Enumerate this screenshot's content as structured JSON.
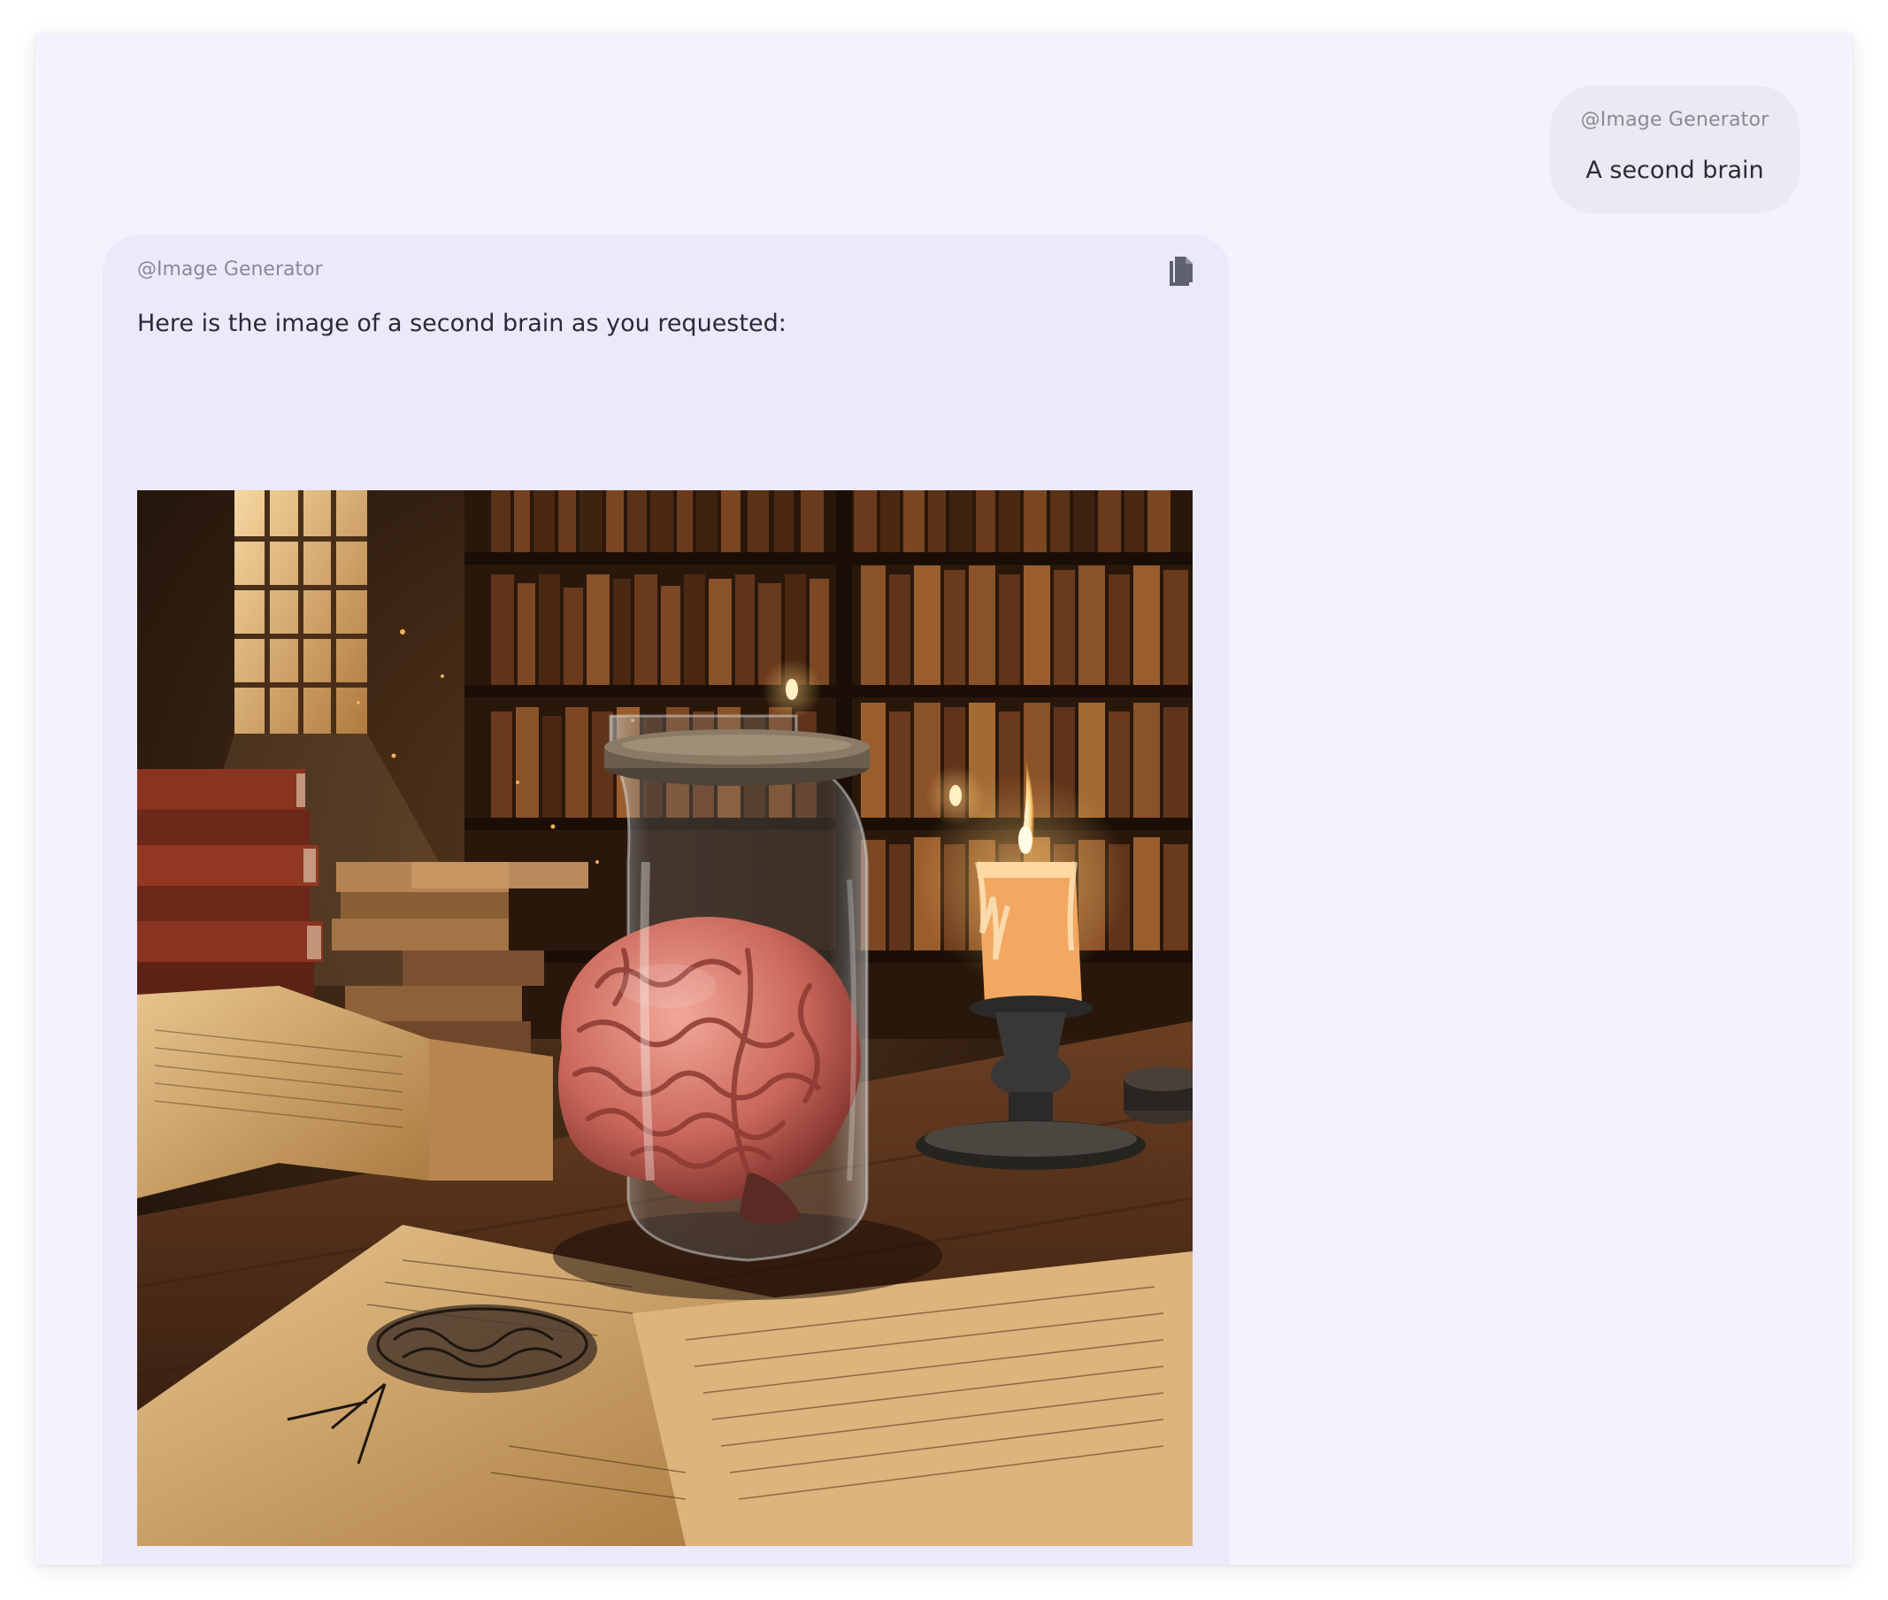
{
  "conversation": {
    "user_message": {
      "handle": "@Image Generator",
      "text": "A second brain"
    },
    "assistant_message": {
      "handle": "@Image Generator",
      "text": "Here is the image of a second brain as you requested:",
      "copy_icon": "copy-icon",
      "image": {
        "content": "brain in a glass jar on a desk in an old library"
      }
    }
  },
  "colors": {
    "frame_bg": "#f4f3fd",
    "user_bubble_bg": "#ebe9f4",
    "assistant_bubble_bg": "#ece9fb",
    "handle_text": "#8a8a93",
    "body_text": "#2a2b33",
    "icon": "#5f6170"
  }
}
